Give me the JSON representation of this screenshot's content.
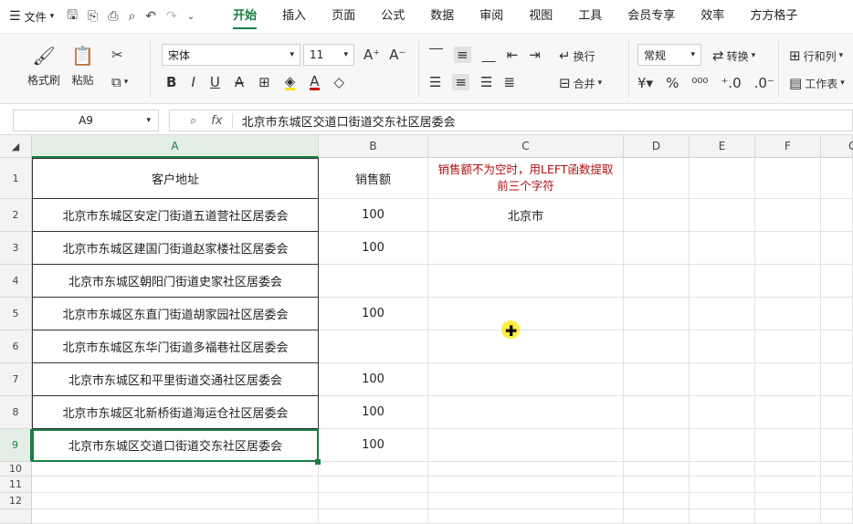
{
  "menubar": {
    "file_label": "文件",
    "tabs": [
      "开始",
      "插入",
      "页面",
      "公式",
      "数据",
      "审阅",
      "视图",
      "工具",
      "会员专享",
      "效率",
      "方方格子"
    ]
  },
  "ribbon": {
    "format_painter": "格式刷",
    "paste": "粘贴",
    "font_name": "宋体",
    "font_size": "11",
    "wrap_text": "换行",
    "merge": "合并",
    "number_format": "常规",
    "convert": "转换",
    "row_col": "行和列",
    "worksheet": "工作表"
  },
  "formula_bar": {
    "name_box": "A9",
    "fx_label": "fx",
    "content": "北京市东城区交道口街道交东社区居委会"
  },
  "columns": [
    "A",
    "B",
    "C",
    "D",
    "E",
    "F",
    "G"
  ],
  "rows": [
    "1",
    "2",
    "3",
    "4",
    "5",
    "6",
    "7",
    "8",
    "9",
    "10",
    "11",
    "12"
  ],
  "table": {
    "header_a": "客户地址",
    "header_b": "销售额",
    "note_c1": "销售额不为空时，用LEFT函数提取前三个字符",
    "rows": [
      {
        "a": "北京市东城区安定门街道五道营社区居委会",
        "b": "100",
        "c": "北京市"
      },
      {
        "a": "北京市东城区建国门街道赵家楼社区居委会",
        "b": "100",
        "c": ""
      },
      {
        "a": "北京市东城区朝阳门街道史家社区居委会",
        "b": "",
        "c": ""
      },
      {
        "a": "北京市东城区东直门街道胡家园社区居委会",
        "b": "100",
        "c": ""
      },
      {
        "a": "北京市东城区东华门街道多福巷社区居委会",
        "b": "",
        "c": ""
      },
      {
        "a": "北京市东城区和平里街道交通社区居委会",
        "b": "100",
        "c": ""
      },
      {
        "a": "北京市东城区北新桥街道海运仓社区居委会",
        "b": "100",
        "c": ""
      },
      {
        "a": "北京市东城区交道口街道交东社区居委会",
        "b": "100",
        "c": ""
      }
    ]
  },
  "colors": {
    "accent": "#1a7e45",
    "note": "#b01010"
  }
}
